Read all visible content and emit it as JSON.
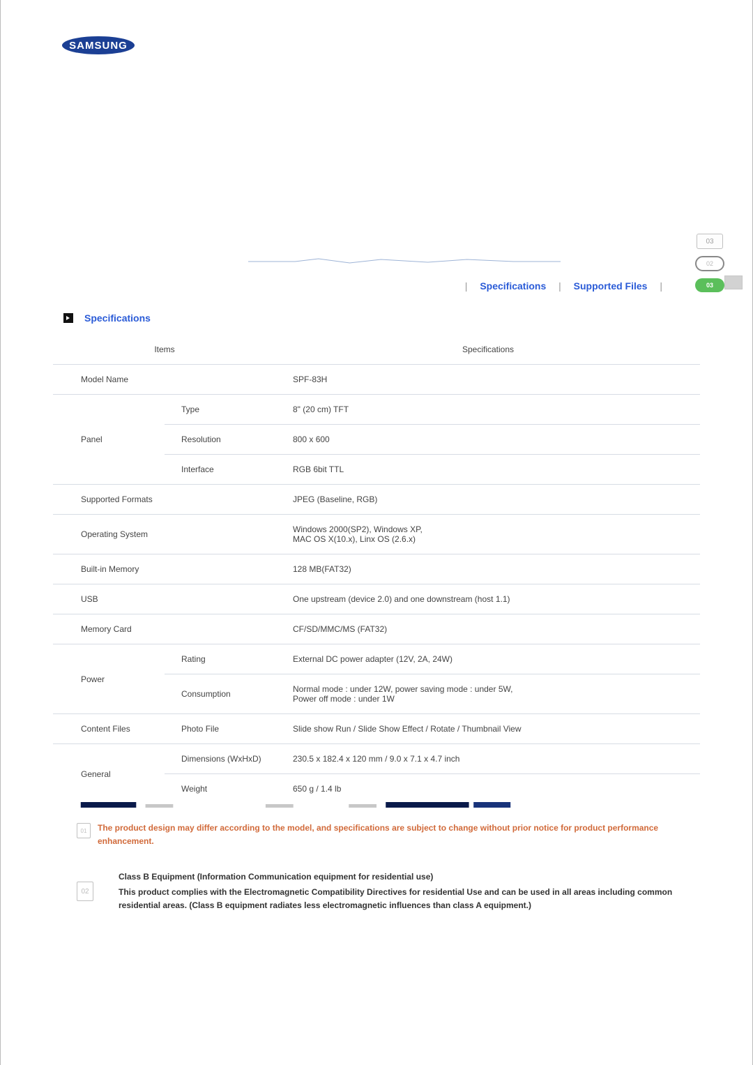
{
  "brand": "SAMSUNG",
  "side": {
    "w1": "03",
    "w2": "02",
    "w3": "03"
  },
  "tabs": {
    "a": "Specifications",
    "b": "Supported Files"
  },
  "section_title": "Specifications",
  "thead": {
    "items": "Items",
    "specs": "Specifications"
  },
  "rows": {
    "model_name_label": "Model Name",
    "model_name_value": "SPF-83H",
    "panel_label": "Panel",
    "panel_type_label": "Type",
    "panel_type_value": "8\" (20 cm) TFT",
    "panel_res_label": "Resolution",
    "panel_res_value": "800 x 600",
    "panel_iface_label": "Interface",
    "panel_iface_value": "RGB 6bit TTL",
    "fmts_label": "Supported Formats",
    "fmts_value": "JPEG (Baseline, RGB)",
    "os_label": "Operating System",
    "os_line1": "Windows 2000(SP2), Windows XP,",
    "os_line2": "MAC OS X(10.x), Linx OS (2.6.x)",
    "mem_label": "Built-in Memory",
    "mem_value": "128 MB(FAT32)",
    "usb_label": "USB",
    "usb_value": "One upstream (device 2.0) and one downstream (host 1.1)",
    "card_label": "Memory Card",
    "card_value": "CF/SD/MMC/MS (FAT32)",
    "power_label": "Power",
    "power_rating_label": "Rating",
    "power_rating_value": "External DC power adapter (12V, 2A, 24W)",
    "power_cons_label": "Consumption",
    "power_cons_line1": "Normal mode : under 12W, power saving mode : under 5W,",
    "power_cons_line2": "Power off mode : under 1W",
    "content_label": "Content Files",
    "content_sub_label": "Photo File",
    "content_value": "Slide show Run / Slide Show Effect / Rotate /  Thumbnail View",
    "general_label": "General",
    "general_dim_label": "Dimensions (WxHxD)",
    "general_dim_value": "230.5 x 182.4 x 120 mm / 9.0 x 7.1 x 4.7 inch",
    "general_weight_label": "Weight",
    "general_weight_value": "650 g / 1.4 lb"
  },
  "note_icon": "01",
  "note_text": "The product design may differ according to the model, and specifications are subject to change without prior notice for product performance enhancement.",
  "classb_icon": "02",
  "classb_title": "Class B Equipment (Information Communication equipment for residential use)",
  "classb_text": "This product complies with the Electromagnetic Compatibility Directives for residential Use and can be used in all areas including common residential areas. (Class B equipment radiates less electromagnetic influences than class A equipment.)"
}
